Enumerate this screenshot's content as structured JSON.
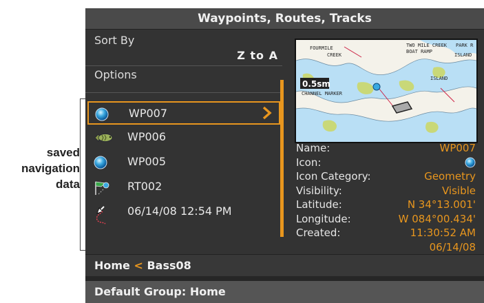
{
  "annotation": {
    "lines": [
      "saved",
      "navigation",
      "data"
    ]
  },
  "window": {
    "title": "Waypoints, Routes, Tracks"
  },
  "left_pane": {
    "sort_label": "Sort By",
    "sort_value": "Z to A",
    "options_label": "Options",
    "items": [
      {
        "label": "WP007",
        "icon": "blue-waypoint-icon",
        "selected": true
      },
      {
        "label": "WP006",
        "icon": "fish-icon",
        "selected": false
      },
      {
        "label": "WP005",
        "icon": "blue-waypoint-icon",
        "selected": false
      },
      {
        "label": "RT002",
        "icon": "route-icon",
        "selected": false
      },
      {
        "label": "06/14/08 12:54 PM",
        "icon": "track-icon",
        "selected": false
      }
    ]
  },
  "map_preview": {
    "scale_label": "0.5sm",
    "place_labels": [
      "FOURMILE",
      "CREEK",
      "TWO MILE CREEK",
      "BOAT RAMP",
      "PARK R",
      "ISLAND",
      "CHANNEL MARKER",
      "ISLAND"
    ]
  },
  "details": {
    "rows": [
      {
        "key": "Name:",
        "value": "WP007"
      },
      {
        "key": "Icon:",
        "value": ""
      },
      {
        "key": "Icon Category:",
        "value": "Geometry"
      },
      {
        "key": "Visibility:",
        "value": "Visible"
      },
      {
        "key": "Latitude:",
        "value": "N 34°13.001'"
      },
      {
        "key": "Longitude:",
        "value": "W 084°00.434'"
      },
      {
        "key": "Created:",
        "value": "11:30:52 AM"
      },
      {
        "key": "",
        "value": "06/14/08"
      }
    ]
  },
  "breadcrumb": {
    "parent": "Home",
    "separator": "<",
    "current": "Bass08"
  },
  "footer": {
    "text": "Default Group: Home"
  },
  "colors": {
    "accent": "#e8961e",
    "background": "#333333",
    "title_bar": "#4a4a4a"
  }
}
